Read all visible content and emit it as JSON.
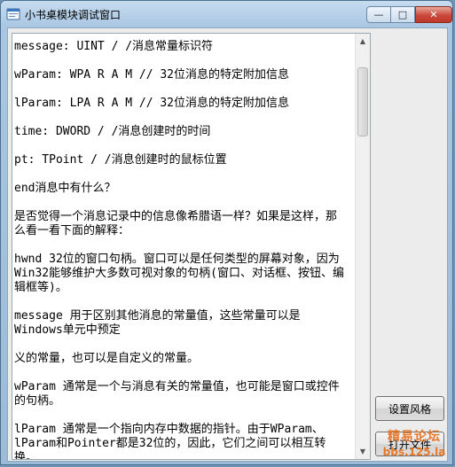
{
  "window": {
    "title": "小书桌模块调试窗口",
    "controls": {
      "minimize": "—",
      "maximize": "□",
      "close": "✕"
    }
  },
  "content": {
    "lines": [
      "message: UINT / /消息常量标识符",
      "wParam: WPA R A M // 32位消息的特定附加信息",
      "lParam: LPA R A M // 32位消息的特定附加信息",
      "time: DWORD / /消息创建时的时间",
      "pt: TPoint / /消息创建时的鼠标位置",
      "end消息中有什么？",
      "是否觉得一个消息记录中的信息像希腊语一样？如果是这样，那么看一看下面的解释：",
      "hwnd 32位的窗口句柄。窗口可以是任何类型的屏幕对象，因为Win32能够维护大多数可视对象的句柄(窗口、对话框、按钮、编辑框等)。",
      "message 用于区别其他消息的常量值，这些常量可以是Windows单元中预定",
      "义的常量，也可以是自定义的常量。",
      "wParam 通常是一个与消息有关的常量值，也可能是窗口或控件的句柄。",
      "lParam 通常是一个指向内存中数据的指针。由于WParam、lParam和Pointer都是32位的，因此，它们之间可以相互转换。"
    ]
  },
  "buttons": {
    "set_style": "设置风格",
    "open": "打开文件"
  },
  "watermark": {
    "line1": "精易论坛",
    "line2": "bbs.125.la"
  }
}
